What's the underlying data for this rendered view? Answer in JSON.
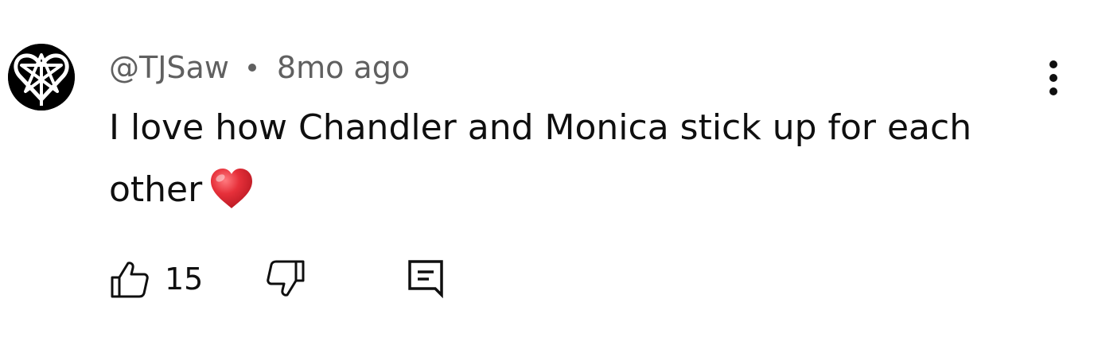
{
  "comment": {
    "author": "@TJSaw",
    "time": "8mo ago",
    "text": "I love how Chandler and Monica stick up for each other",
    "emoji_icon": "red-heart-icon",
    "avatar_icon": "heartagram-icon",
    "like_count": "15",
    "icons": {
      "like": "thumb-up-icon",
      "dislike": "thumb-down-icon",
      "reply": "comment-icon",
      "menu": "more-vertical-icon"
    }
  },
  "colors": {
    "text_primary": "#0f0f0f",
    "text_secondary": "#606060",
    "heart": "#e6303a",
    "background": "#ffffff"
  }
}
